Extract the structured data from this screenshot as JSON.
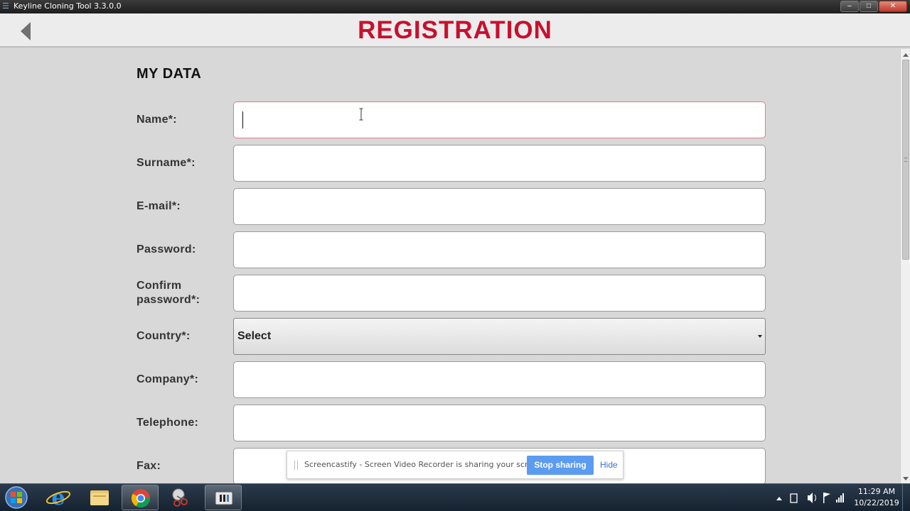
{
  "window": {
    "title": "Keyline Cloning Tool 3.3.0.0",
    "minimize": "–",
    "maximize": "□",
    "close": "✕"
  },
  "header": {
    "title": "REGISTRATION",
    "accent_color": "#c8102e"
  },
  "form": {
    "section_title": "MY DATA",
    "fields": [
      {
        "label": "Name*:",
        "value": "",
        "active": true
      },
      {
        "label": "Surname*:",
        "value": ""
      },
      {
        "label": "E-mail*:",
        "value": ""
      },
      {
        "label": "Password:",
        "value": ""
      },
      {
        "label": "Confirm password*:",
        "value": ""
      },
      {
        "label": "Country*:",
        "value": "Select",
        "type": "select"
      },
      {
        "label": "Company*:",
        "value": ""
      },
      {
        "label": "Telephone:",
        "value": ""
      },
      {
        "label": "Fax:",
        "value": ""
      }
    ]
  },
  "screencastify": {
    "message": "Screencastify - Screen Video Recorder is sharing your screen.",
    "stop_label": "Stop sharing",
    "hide_label": "Hide"
  },
  "taskbar": {
    "time": "11:29 AM",
    "date": "10/22/2019"
  }
}
